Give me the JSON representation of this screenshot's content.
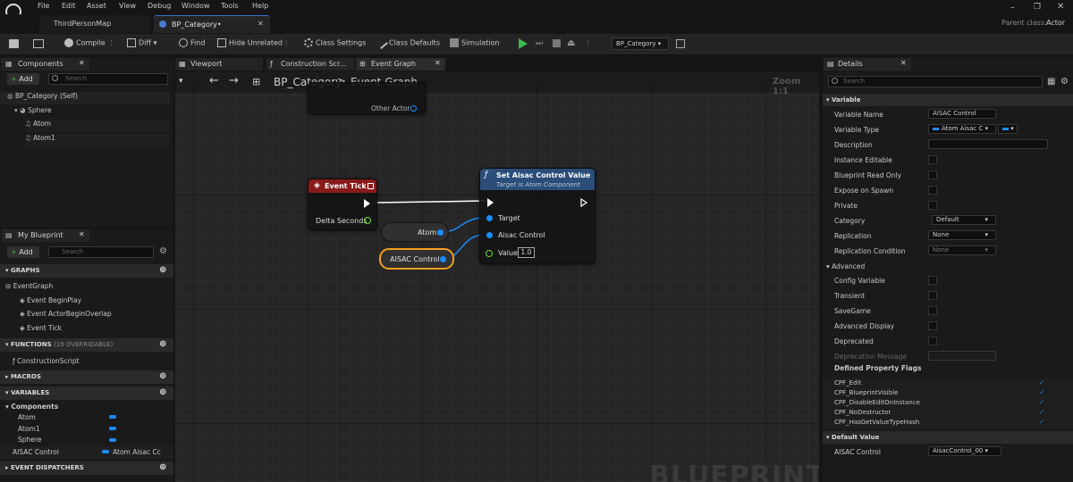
{
  "menu": [
    "File",
    "Edit",
    "Asset",
    "View",
    "Debug",
    "Window",
    "Tools",
    "Help"
  ],
  "tabs": [
    {
      "label": "ThirdPersonMap"
    },
    {
      "label": "BP_Category•"
    }
  ],
  "parent_class": {
    "label": "Parent class:",
    "value": "Actor"
  },
  "toolbar": {
    "compile": "Compile",
    "diff": "Diff",
    "find": "Find",
    "hide_unrelated": "Hide Unrelated",
    "class_settings": "Class Settings",
    "class_defaults": "Class Defaults",
    "simulation": "Simulation",
    "debug_object": "BP_Category"
  },
  "components": {
    "tab": "Components",
    "add": "Add",
    "search_placeholder": "Search",
    "items": [
      "BP_Category (Self)",
      "Sphere",
      "Atom",
      "Atom1"
    ]
  },
  "editor_tabs": [
    "Viewport",
    "Construction Scr...",
    "Event Graph"
  ],
  "graph": {
    "breadcrumb_root": "BP_Category",
    "breadcrumb_sep": ">",
    "breadcrumb_leaf": "Event Graph",
    "zoom": "Zoom 1:1",
    "watermark": "BLUEPRINT",
    "other_actor": "Other Actor",
    "event_tick": {
      "title": "Event Tick",
      "delta": "Delta Seconds"
    },
    "atom_var": "Atom",
    "aisac_var": "AISAC Control",
    "set_node": {
      "title": "Set Aisac Control Value",
      "subtitle": "Target is Atom Component",
      "target": "Target",
      "aisac": "Aisac Control",
      "value_label": "Value",
      "value": "1.0"
    }
  },
  "my_blueprint": {
    "tab": "My Blueprint",
    "add": "Add",
    "search_placeholder": "Search",
    "graphs_head": "GRAPHS",
    "event_graph": "EventGraph",
    "events": [
      "Event BeginPlay",
      "Event ActorBeginOverlap",
      "Event Tick"
    ],
    "functions_head": "FUNCTIONS",
    "functions_note": "(19 OVERRIDABLE)",
    "construction": "ConstructionScript",
    "macros_head": "MACROS",
    "variables_head": "VARIABLES",
    "components_head": "Components",
    "vars": [
      "Atom",
      "Atom1",
      "Sphere"
    ],
    "aisac_name": "AISAC Control",
    "aisac_type": "Atom Aisac Cc",
    "dispatchers_head": "EVENT DISPATCHERS"
  },
  "details": {
    "tab": "Details",
    "search_placeholder": "Search",
    "variable_head": "Variable",
    "variable_name_label": "Variable Name",
    "variable_name": "AISAC Control",
    "variable_type_label": "Variable Type",
    "variable_type": "Atom Aisac C",
    "description_label": "Description",
    "instance_editable": "Instance Editable",
    "bp_read_only": "Blueprint Read Only",
    "expose_spawn": "Expose on Spawn",
    "private": "Private",
    "category_label": "Category",
    "category": "Default",
    "replication_label": "Replication",
    "replication": "None",
    "rep_cond_label": "Replication Condition",
    "rep_cond": "None",
    "advanced_head": "Advanced",
    "config_var": "Config Variable",
    "transient": "Transient",
    "savegame": "SaveGame",
    "adv_display": "Advanced Display",
    "deprecated": "Deprecated",
    "dep_msg": "Deprecation Message",
    "flags_head": "Defined Property Flags",
    "flags": [
      "CPF_Edit",
      "CPF_BlueprintVisible",
      "CPF_DisableEditOnInstance",
      "CPF_NoDestructor",
      "CPF_HasGetValueTypeHash"
    ],
    "default_head": "Default Value",
    "aisac_label": "AISAC Control",
    "aisac_value": "AisacControl_00"
  },
  "colors": {
    "accent": "#1a8cff",
    "event_red": "#8a1a1a",
    "func_blue": "#2a4d7a",
    "exec": "#ffffff",
    "float": "#6bdc3a",
    "play": "#3cb84a"
  }
}
